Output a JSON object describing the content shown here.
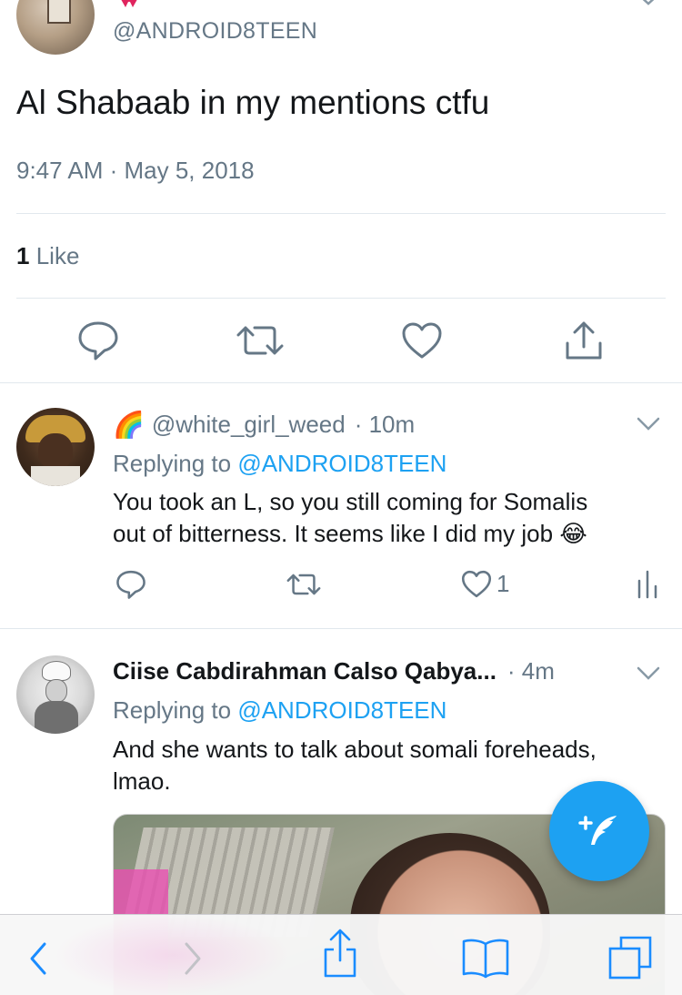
{
  "tweet": {
    "handle": "@ANDROID8TEEN",
    "text": "Al Shabaab in my mentions ctfu",
    "timestamp": "9:47 AM · May 5, 2018",
    "like_count": "1",
    "like_label": "Like"
  },
  "replies": [
    {
      "emoji": "🌈",
      "handle": "@white_girl_weed",
      "time": "· 10m",
      "replying_prefix": "Replying to",
      "replying_to": "@ANDROID8TEEN",
      "text_line1": "You took an L, so you still coming for Somalis",
      "text_line2": "out of bitterness. It seems like I did my job",
      "text_emoji": "😂",
      "like_count": "1"
    },
    {
      "name": "Ciise Cabdirahman Calso Qabya...",
      "time": "· 4m",
      "replying_prefix": "Replying to",
      "replying_to": "@ANDROID8TEEN",
      "text_line1": "And she wants to talk about somali foreheads,",
      "text_line2": "lmao."
    }
  ],
  "colors": {
    "accent": "#1da1f2",
    "secondary_text": "#657786",
    "primary_text": "#14171a",
    "divider": "#e1e8ed"
  }
}
